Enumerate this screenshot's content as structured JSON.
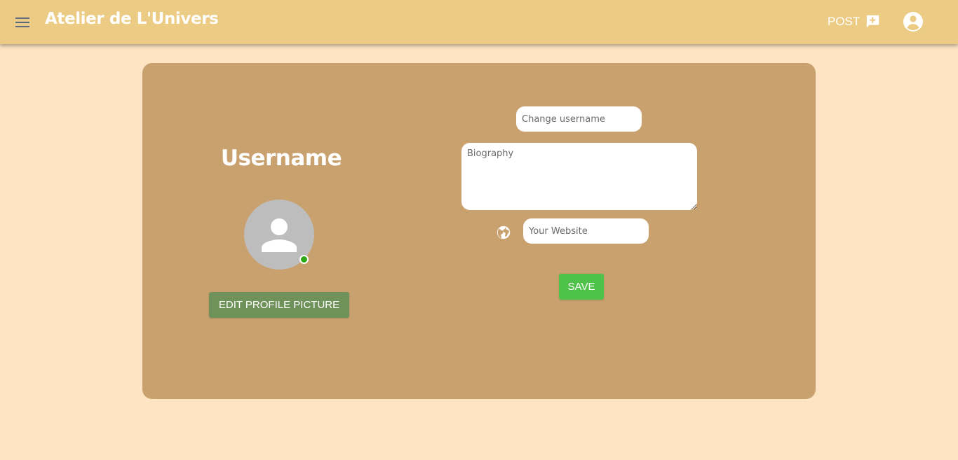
{
  "app": {
    "title": "Atelier de L'Univers"
  },
  "header": {
    "post_label": "POST",
    "icons": {
      "menu": "menu-icon",
      "post": "add-comment-icon",
      "account": "account-circle-icon"
    }
  },
  "profile": {
    "username_heading": "Username",
    "status": "online",
    "edit_picture_label": "EDIT PROFILE PICTURE"
  },
  "form": {
    "username_placeholder": "Change username",
    "username_value": "",
    "biography_placeholder": "Biography",
    "biography_value": "",
    "website_placeholder": "Your Website",
    "website_value": "",
    "website_icon": "globe-icon",
    "save_label": "SAVE"
  },
  "colors": {
    "page_background": "#fee4c2",
    "appbar": "#eccb84",
    "card": "#c9a16f",
    "edit_button": "#6f925a",
    "save_button": "#4fc24a",
    "online_status": "#2eaa16",
    "avatar_placeholder": "#bdbdbd"
  }
}
